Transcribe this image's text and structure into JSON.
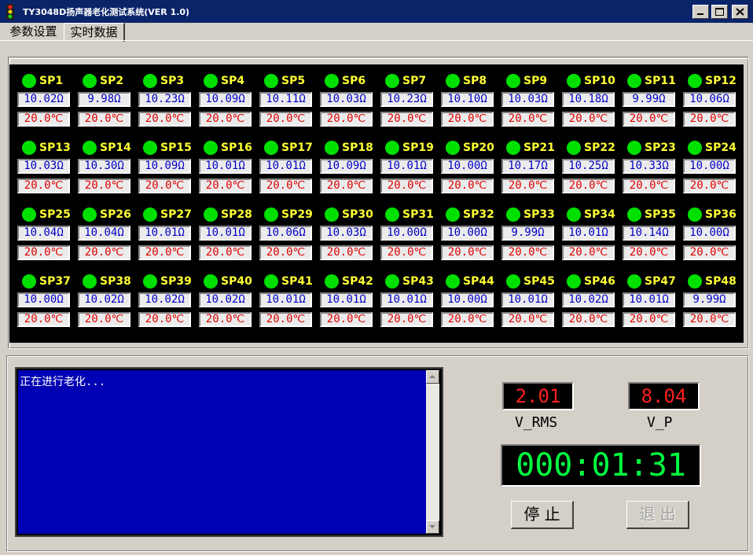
{
  "window": {
    "title": "TY3048D扬声器老化测试系统(VER 1.0)",
    "icon": "traffic-light-icon"
  },
  "tabs": [
    {
      "label": "参数设置",
      "selected": false
    },
    {
      "label": "实时数据",
      "selected": true
    }
  ],
  "speakers": [
    {
      "name": "SP1",
      "resistance": "10.02Ω",
      "temperature": "20.0℃"
    },
    {
      "name": "SP2",
      "resistance": " 9.98Ω",
      "temperature": "20.0℃"
    },
    {
      "name": "SP3",
      "resistance": "10.23Ω",
      "temperature": "20.0℃"
    },
    {
      "name": "SP4",
      "resistance": "10.09Ω",
      "temperature": "20.0℃"
    },
    {
      "name": "SP5",
      "resistance": "10.11Ω",
      "temperature": "20.0℃"
    },
    {
      "name": "SP6",
      "resistance": "10.03Ω",
      "temperature": "20.0℃"
    },
    {
      "name": "SP7",
      "resistance": "10.23Ω",
      "temperature": "20.0℃"
    },
    {
      "name": "SP8",
      "resistance": "10.10Ω",
      "temperature": "20.0℃"
    },
    {
      "name": "SP9",
      "resistance": "10.03Ω",
      "temperature": "20.0℃"
    },
    {
      "name": "SP10",
      "resistance": "10.18Ω",
      "temperature": "20.0℃"
    },
    {
      "name": "SP11",
      "resistance": " 9.99Ω",
      "temperature": "20.0℃"
    },
    {
      "name": "SP12",
      "resistance": "10.06Ω",
      "temperature": "20.0℃"
    },
    {
      "name": "SP13",
      "resistance": "10.03Ω",
      "temperature": "20.0℃"
    },
    {
      "name": "SP14",
      "resistance": "10.30Ω",
      "temperature": "20.0℃"
    },
    {
      "name": "SP15",
      "resistance": "10.09Ω",
      "temperature": "20.0℃"
    },
    {
      "name": "SP16",
      "resistance": "10.01Ω",
      "temperature": "20.0℃"
    },
    {
      "name": "SP17",
      "resistance": "10.01Ω",
      "temperature": "20.0℃"
    },
    {
      "name": "SP18",
      "resistance": "10.09Ω",
      "temperature": "20.0℃"
    },
    {
      "name": "SP19",
      "resistance": "10.01Ω",
      "temperature": "20.0℃"
    },
    {
      "name": "SP20",
      "resistance": "10.00Ω",
      "temperature": "20.0℃"
    },
    {
      "name": "SP21",
      "resistance": "10.17Ω",
      "temperature": "20.0℃"
    },
    {
      "name": "SP22",
      "resistance": "10.25Ω",
      "temperature": "20.0℃"
    },
    {
      "name": "SP23",
      "resistance": "10.33Ω",
      "temperature": "20.0℃"
    },
    {
      "name": "SP24",
      "resistance": "10.00Ω",
      "temperature": "20.0℃"
    },
    {
      "name": "SP25",
      "resistance": "10.04Ω",
      "temperature": "20.0℃"
    },
    {
      "name": "SP26",
      "resistance": "10.04Ω",
      "temperature": "20.0℃"
    },
    {
      "name": "SP27",
      "resistance": "10.01Ω",
      "temperature": "20.0℃"
    },
    {
      "name": "SP28",
      "resistance": "10.01Ω",
      "temperature": "20.0℃"
    },
    {
      "name": "SP29",
      "resistance": "10.06Ω",
      "temperature": "20.0℃"
    },
    {
      "name": "SP30",
      "resistance": "10.03Ω",
      "temperature": "20.0℃"
    },
    {
      "name": "SP31",
      "resistance": "10.00Ω",
      "temperature": "20.0℃"
    },
    {
      "name": "SP32",
      "resistance": "10.00Ω",
      "temperature": "20.0℃"
    },
    {
      "name": "SP33",
      "resistance": " 9.99Ω",
      "temperature": "20.0℃"
    },
    {
      "name": "SP34",
      "resistance": "10.01Ω",
      "temperature": "20.0℃"
    },
    {
      "name": "SP35",
      "resistance": "10.14Ω",
      "temperature": "20.0℃"
    },
    {
      "name": "SP36",
      "resistance": "10.00Ω",
      "temperature": "20.0℃"
    },
    {
      "name": "SP37",
      "resistance": "10.00Ω",
      "temperature": "20.0℃"
    },
    {
      "name": "SP38",
      "resistance": "10.02Ω",
      "temperature": "20.0℃"
    },
    {
      "name": "SP39",
      "resistance": "10.02Ω",
      "temperature": "20.0℃"
    },
    {
      "name": "SP40",
      "resistance": "10.02Ω",
      "temperature": "20.0℃"
    },
    {
      "name": "SP41",
      "resistance": "10.01Ω",
      "temperature": "20.0℃"
    },
    {
      "name": "SP42",
      "resistance": "10.01Ω",
      "temperature": "20.0℃"
    },
    {
      "name": "SP43",
      "resistance": "10.01Ω",
      "temperature": "20.0℃"
    },
    {
      "name": "SP44",
      "resistance": "10.00Ω",
      "temperature": "20.0℃"
    },
    {
      "name": "SP45",
      "resistance": "10.01Ω",
      "temperature": "20.0℃"
    },
    {
      "name": "SP46",
      "resistance": "10.02Ω",
      "temperature": "20.0℃"
    },
    {
      "name": "SP47",
      "resistance": "10.01Ω",
      "temperature": "20.0℃"
    },
    {
      "name": "SP48",
      "resistance": " 9.99Ω",
      "temperature": "20.0℃"
    }
  ],
  "log": {
    "text": "正在进行老化..."
  },
  "readouts": {
    "v_rms_value": "2.01",
    "v_rms_label": "V_RMS",
    "v_p_value": "8.04",
    "v_p_label": "V_P",
    "timer": "000:01:31"
  },
  "buttons": {
    "stop": "停 止",
    "exit": "退 出",
    "exit_enabled": false
  },
  "colors": {
    "title_bar": "#0a246a",
    "status_led": "#00e000",
    "speaker_label": "#ffff33",
    "resistance_text": "#0000c8",
    "temperature_text": "#e00000",
    "log_background": "#0000b4",
    "voltage_digits": "#ff2020",
    "timer_digits": "#00ff40"
  }
}
